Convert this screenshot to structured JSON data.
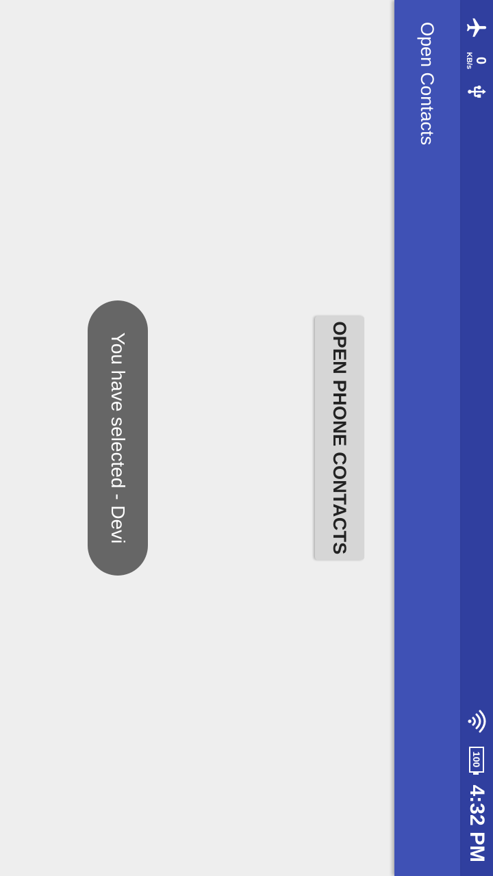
{
  "status_bar": {
    "icons_left": [
      "airplane-mode-icon",
      "usb-icon"
    ],
    "net_speed_value": "0",
    "net_speed_unit": "KB/s",
    "icons_right": [
      "wifi-icon",
      "battery-icon"
    ],
    "battery_level": "100",
    "time": "4:32 PM",
    "background_color": "#303f9f"
  },
  "app_bar": {
    "title": "Open Contacts",
    "background_color": "#3f51b5"
  },
  "main": {
    "open_contacts_button_label": "OPEN PHONE CONTACTS"
  },
  "toast": {
    "message": "You have selected - Devi"
  }
}
